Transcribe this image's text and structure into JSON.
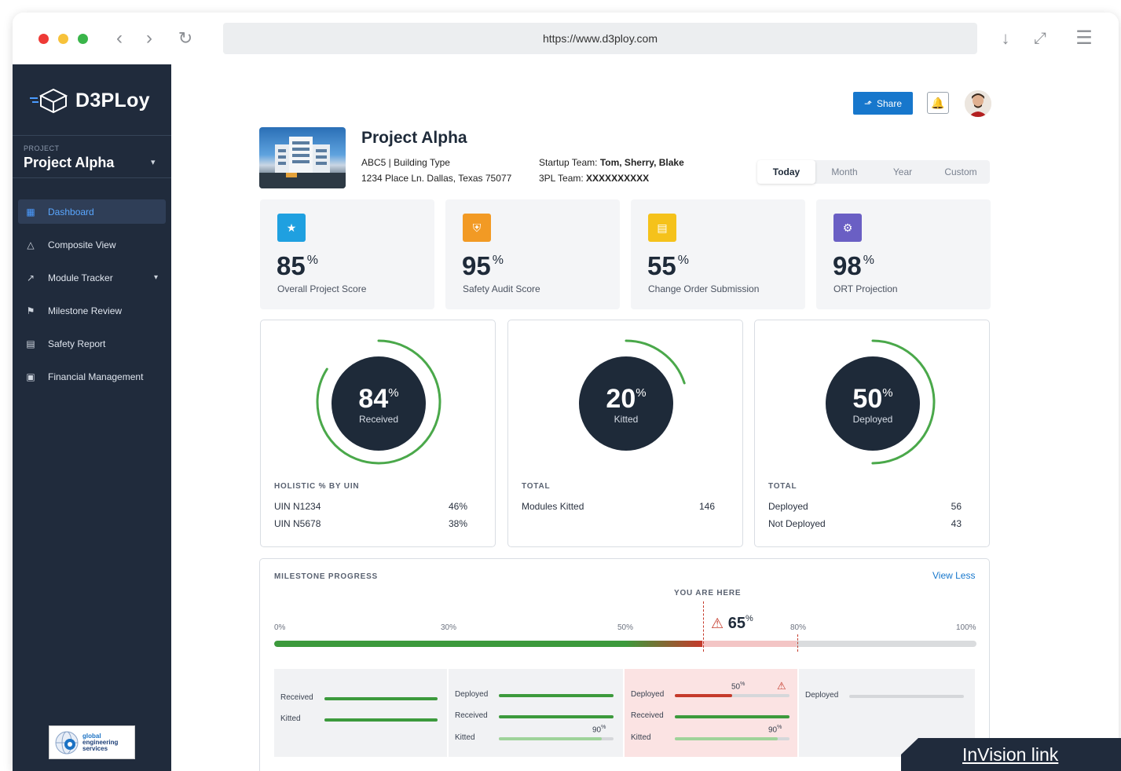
{
  "browser": {
    "url": "https://www.d3ploy.com"
  },
  "sidebar": {
    "brand": "D3PLoy",
    "project_label": "PROJECT",
    "project_name": "Project Alpha",
    "items": [
      {
        "label": "Dashboard",
        "icon": "dashboard-icon"
      },
      {
        "label": "Composite View",
        "icon": "composite-view-icon"
      },
      {
        "label": "Module Tracker",
        "icon": "trend-icon"
      },
      {
        "label": "Milestone Review",
        "icon": "flag-icon"
      },
      {
        "label": "Safety Report",
        "icon": "document-icon"
      },
      {
        "label": "Financial Management",
        "icon": "money-icon"
      }
    ],
    "footer_logo_text": [
      "global",
      "engineering",
      "services"
    ]
  },
  "header": {
    "share_label": "Share"
  },
  "project": {
    "title": "Project Alpha",
    "line1": "ABC5 | Building Type",
    "line2": "1234 Place Ln. Dallas, Texas 75077",
    "startup_label": "Startup Team:",
    "startup_value": "Tom, Sherry, Blake",
    "tpl_label": "3PL Team:",
    "tpl_value": "XXXXXXXXXX"
  },
  "periods": [
    "Today",
    "Month",
    "Year",
    "Custom"
  ],
  "stats": [
    {
      "value": "85",
      "unit": "%",
      "label": "Overall Project Score",
      "color": "#1fa0e0",
      "icon": "star-icon"
    },
    {
      "value": "95",
      "unit": "%",
      "label": "Safety Audit Score",
      "color": "#f29a24",
      "icon": "shield-icon"
    },
    {
      "value": "55",
      "unit": "%",
      "label": "Change Order Submission",
      "color": "#f5c21b",
      "icon": "document-icon"
    },
    {
      "value": "98",
      "unit": "%",
      "label": "ORT Projection",
      "color": "#6a5fc4",
      "icon": "gear-icon"
    }
  ],
  "rings": [
    {
      "value": "84",
      "unit": "%",
      "sub": "Received",
      "progress": 0.84,
      "head": "HOLISTIC % BY UIN",
      "rows": [
        {
          "k": "UIN N1234",
          "v": "46%"
        },
        {
          "k": "UIN N5678",
          "v": "38%"
        }
      ]
    },
    {
      "value": "20",
      "unit": "%",
      "sub": "Kitted",
      "progress": 0.2,
      "head": "TOTAL",
      "rows": [
        {
          "k": "Modules Kitted",
          "v": "146"
        }
      ]
    },
    {
      "value": "50",
      "unit": "%",
      "sub": "Deployed",
      "progress": 0.5,
      "head": "TOTAL",
      "rows": [
        {
          "k": "Deployed",
          "v": "56"
        },
        {
          "k": "Not Deployed",
          "v": "43"
        }
      ]
    }
  ],
  "milestone": {
    "title": "MILESTONE PROGRESS",
    "view_less": "View Less",
    "you_are_here": "YOU ARE HERE",
    "ticks": [
      "0%",
      "30%",
      "50%",
      "80%",
      "100%"
    ],
    "current_value": "65",
    "current_unit": "%",
    "progress": 0.61,
    "phases": [
      {
        "rows": [
          {
            "label": "Received",
            "fill": 1.0
          },
          {
            "label": "Kitted",
            "fill": 1.0
          }
        ]
      },
      {
        "rows": [
          {
            "label": "Deployed",
            "fill": 1.0
          },
          {
            "label": "Received",
            "fill": 1.0
          },
          {
            "label": "Kitted",
            "fill": 0.9,
            "pct": "90"
          }
        ]
      },
      {
        "rows": [
          {
            "label": "Deployed",
            "fill": 0.5,
            "pct": "50",
            "warn": true
          },
          {
            "label": "Received",
            "fill": 1.0
          },
          {
            "label": "Kitted",
            "fill": 0.9,
            "pct": "90"
          }
        ]
      },
      {
        "rows": [
          {
            "label": "Deployed",
            "fill": 0.0
          }
        ]
      }
    ]
  },
  "invision_link": "InVision link"
}
